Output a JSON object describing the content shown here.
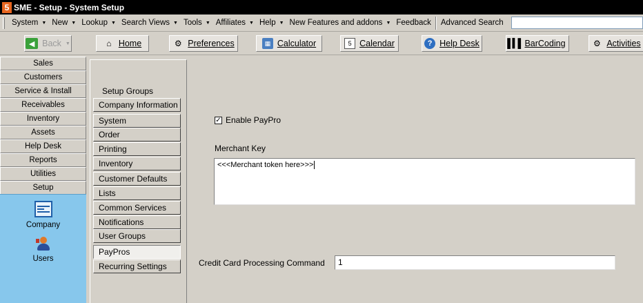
{
  "window": {
    "title": "SME - Setup - System Setup",
    "app_icon_glyph": "5"
  },
  "menubar": {
    "items": [
      {
        "label": "System"
      },
      {
        "label": "New"
      },
      {
        "label": "Lookup"
      },
      {
        "label": "Search Views"
      },
      {
        "label": "Tools"
      },
      {
        "label": "Affiliates"
      },
      {
        "label": "Help"
      },
      {
        "label": "New Features and addons"
      },
      {
        "label": "Feedback"
      }
    ],
    "advanced_search_label": "Advanced Search",
    "advanced_search_value": ""
  },
  "toolbar": {
    "back": "Back",
    "home": "Home",
    "preferences": "Preferences",
    "calculator": "Calculator",
    "calendar": "Calendar",
    "helpdesk": "Help Desk",
    "barcoding": "BarCoding",
    "activities": "Activities"
  },
  "nav": {
    "items": [
      "Sales",
      "Customers",
      "Service & Install",
      "Receivables",
      "Inventory",
      "Assets",
      "Help Desk",
      "Reports",
      "Utilities",
      "Setup"
    ],
    "tools": [
      "Company",
      "Users"
    ]
  },
  "setup_groups": {
    "title": "Setup Groups",
    "items": [
      "Company Information",
      "System",
      "Order",
      "Printing",
      "Inventory",
      "Customer Defaults",
      "Lists",
      "Common Services",
      "Notifications",
      "User Groups",
      "PayPros",
      "Recurring Settings"
    ],
    "selected": "PayPros"
  },
  "paypro": {
    "enable_label": "Enable PayPro",
    "enable_checked": true,
    "merchant_key_label": "Merchant Key",
    "merchant_key_value": "<<<Merchant token here>>>",
    "cc_command_label": "Credit Card Processing Command",
    "cc_command_value": "1"
  },
  "colors": {
    "nav_panel": "#87c7ec",
    "title_bar": "#000000",
    "window_bg": "#d4d0c8"
  }
}
